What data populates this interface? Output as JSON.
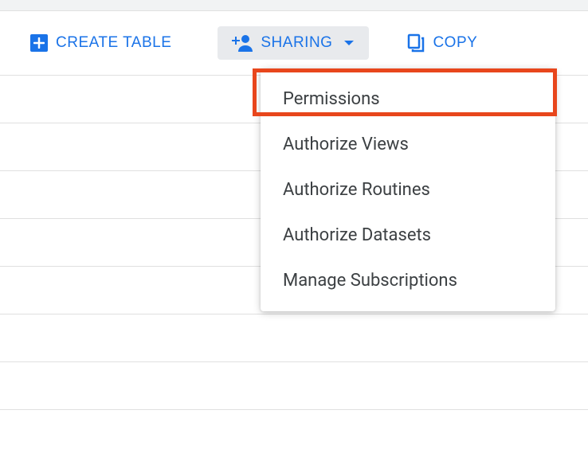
{
  "toolbar": {
    "create_table_label": "CREATE TABLE",
    "sharing_label": "SHARING",
    "copy_label": "COPY"
  },
  "sharing_menu": {
    "items": [
      {
        "label": "Permissions"
      },
      {
        "label": "Authorize Views"
      },
      {
        "label": "Authorize Routines"
      },
      {
        "label": "Authorize Datasets"
      },
      {
        "label": "Manage Subscriptions"
      }
    ]
  },
  "highlight": {
    "target": "Permissions"
  }
}
